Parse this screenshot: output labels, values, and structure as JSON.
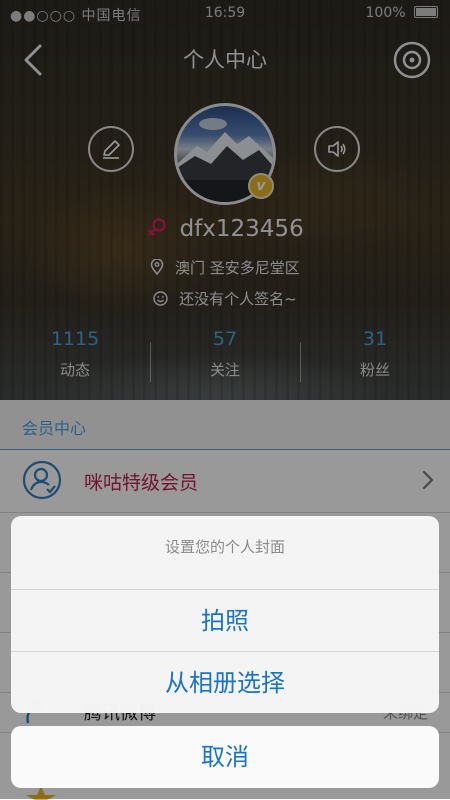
{
  "status_bar": {
    "carrier": "●●○○○ 中国电信",
    "time": "16:59",
    "battery": "100%"
  },
  "nav": {
    "title": "个人中心",
    "back_icon": "chevron-left-icon",
    "right_icon": "disc-icon"
  },
  "profile": {
    "username": "dfx123456",
    "location": "澳门  圣安多尼堂区",
    "signature": "还没有个人签名~",
    "vip_badge": "v",
    "stats": [
      {
        "value": "1115",
        "label": "动态"
      },
      {
        "value": "57",
        "label": "关注"
      },
      {
        "value": "31",
        "label": "粉丝"
      }
    ]
  },
  "list": {
    "section_title": "会员中心",
    "member_label": "咪咕特级会员",
    "partial_row_label": "腾讯微博",
    "partial_row_value": "未绑定"
  },
  "action_sheet": {
    "title": "设置您的个人封面",
    "option_photo": "拍照",
    "option_album": "从相册选择",
    "cancel": "取消"
  },
  "colors": {
    "accent_blue": "#1a72c9",
    "stat_blue": "#4aa3e0",
    "member_red": "#c0224f",
    "vip_gold": "#e6b42c"
  }
}
